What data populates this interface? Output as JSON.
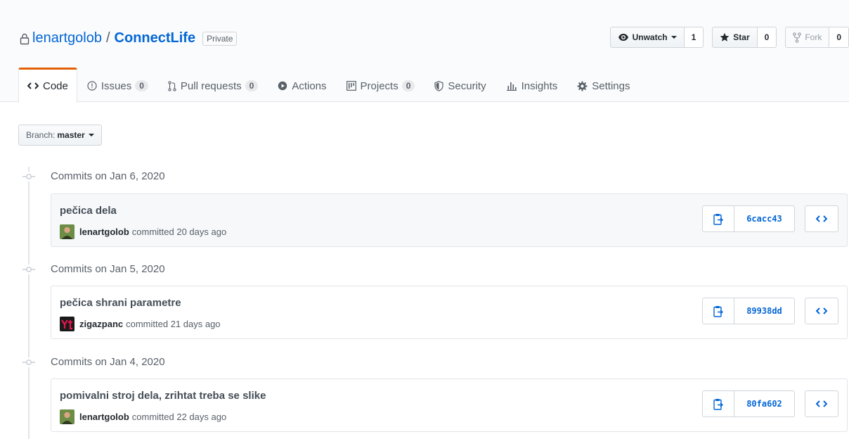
{
  "repo": {
    "owner": "lenartgolob",
    "separator": "/",
    "name": "ConnectLife",
    "visibility": "Private"
  },
  "actions": {
    "watch_label": "Unwatch",
    "watch_count": "1",
    "star_label": "Star",
    "star_count": "0",
    "fork_label": "Fork",
    "fork_count": "0"
  },
  "tabs": [
    {
      "label": "Code",
      "icon": "code-icon",
      "selected": true
    },
    {
      "label": "Issues",
      "icon": "issue-icon",
      "count": "0"
    },
    {
      "label": "Pull requests",
      "icon": "pull-request-icon",
      "count": "0"
    },
    {
      "label": "Actions",
      "icon": "play-icon"
    },
    {
      "label": "Projects",
      "icon": "project-icon",
      "count": "0"
    },
    {
      "label": "Security",
      "icon": "shield-icon"
    },
    {
      "label": "Insights",
      "icon": "graph-icon"
    },
    {
      "label": "Settings",
      "icon": "gear-icon"
    }
  ],
  "branch": {
    "prefix": "Branch:",
    "name": "master"
  },
  "commit_groups": [
    {
      "title": "Commits on Jan 6, 2020",
      "commit": {
        "message": "pečica dela",
        "author": "lenartgolob",
        "meta": "committed 20 days ago",
        "sha": "6cacc43"
      }
    },
    {
      "title": "Commits on Jan 5, 2020",
      "commit": {
        "message": "pečica shrani parametre",
        "author": "zigazpanc",
        "meta": "committed 21 days ago",
        "sha": "89938dd"
      }
    },
    {
      "title": "Commits on Jan 4, 2020",
      "commit": {
        "message": "pomivalni stroj dela, zrihtat treba se slike",
        "author": "lenartgolob",
        "meta": "committed 22 days ago",
        "sha": "80fa602"
      }
    }
  ],
  "colors": {
    "link": "#0366d6",
    "selected_tab_accent": "#e36209",
    "highlight_row": "#f6f8fa"
  }
}
